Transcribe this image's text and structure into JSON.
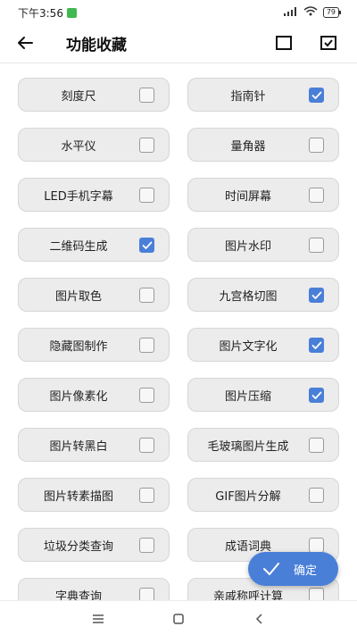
{
  "status_bar": {
    "time": "下午3:56",
    "battery": "79"
  },
  "header": {
    "title": "功能收藏"
  },
  "icons": {
    "back": "back-arrow-icon",
    "select_none": "empty-square-icon",
    "select_all": "checked-square-icon",
    "confirm": "check-icon"
  },
  "colors": {
    "accent": "#4a7fd8",
    "item_bg": "#ececec"
  },
  "items": [
    {
      "label": "刻度尺",
      "checked": false
    },
    {
      "label": "指南针",
      "checked": true
    },
    {
      "label": "水平仪",
      "checked": false
    },
    {
      "label": "量角器",
      "checked": false
    },
    {
      "label": "LED手机字幕",
      "checked": false
    },
    {
      "label": "时间屏幕",
      "checked": false
    },
    {
      "label": "二维码生成",
      "checked": true
    },
    {
      "label": "图片水印",
      "checked": false
    },
    {
      "label": "图片取色",
      "checked": false
    },
    {
      "label": "九宫格切图",
      "checked": true
    },
    {
      "label": "隐藏图制作",
      "checked": false
    },
    {
      "label": "图片文字化",
      "checked": true
    },
    {
      "label": "图片像素化",
      "checked": false
    },
    {
      "label": "图片压缩",
      "checked": true
    },
    {
      "label": "图片转黑白",
      "checked": false
    },
    {
      "label": "毛玻璃图片生成",
      "checked": false
    },
    {
      "label": "图片转素描图",
      "checked": false
    },
    {
      "label": "GIF图片分解",
      "checked": false
    },
    {
      "label": "垃圾分类查询",
      "checked": false
    },
    {
      "label": "成语词典",
      "checked": false
    },
    {
      "label": "字典查询",
      "checked": false
    },
    {
      "label": "亲戚称呼计算",
      "checked": false
    }
  ],
  "fab": {
    "label": "确定"
  }
}
